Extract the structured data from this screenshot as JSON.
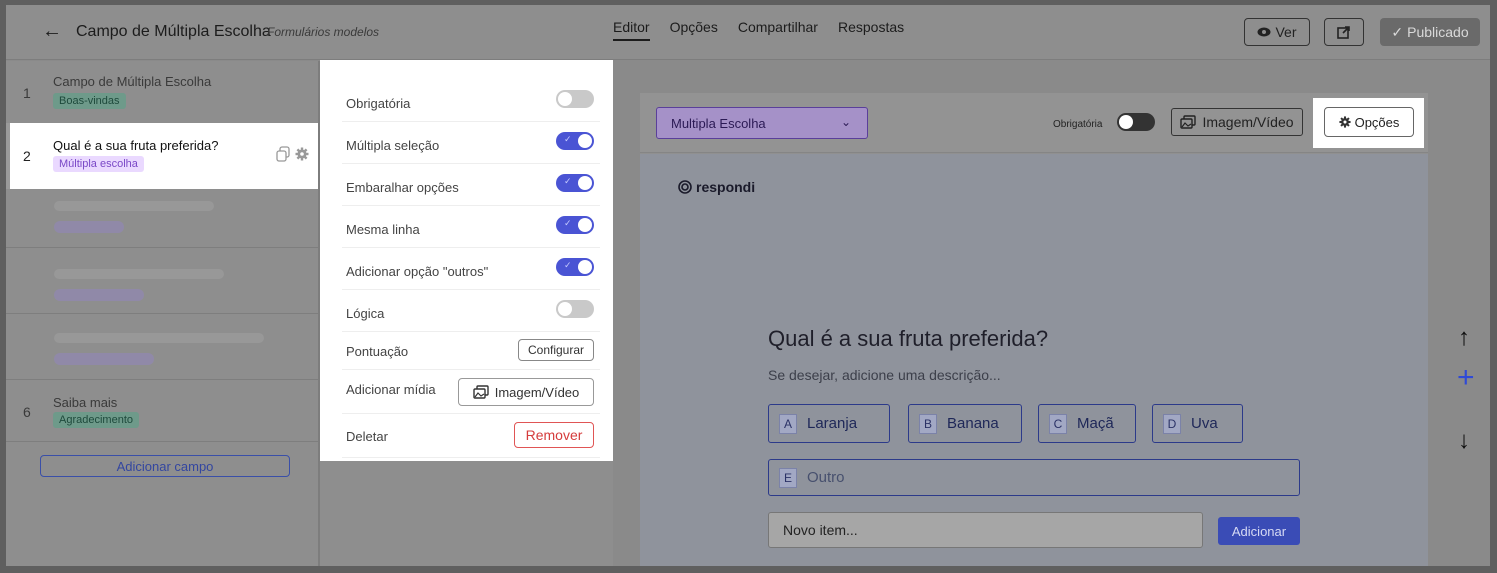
{
  "header": {
    "back_icon": "arrow-left-icon",
    "title": "Campo de Múltipla Escolha",
    "subtitle": "Formulários modelos",
    "tabs": [
      {
        "label": "Editor",
        "active": true
      },
      {
        "label": "Opções"
      },
      {
        "label": "Compartilhar"
      },
      {
        "label": "Respostas"
      }
    ],
    "view_button": "Ver",
    "publish_button": "Publicado"
  },
  "fields": {
    "items": [
      {
        "num": "1",
        "title": "Campo de Múltipla Escolha",
        "tag": "Boas-vindas"
      },
      {
        "num": "2",
        "title": "Qual é a sua fruta preferida?",
        "tag": "Múltipla escolha"
      },
      {
        "num": "6",
        "title": "Saiba mais",
        "tag": "Agradecimento"
      }
    ],
    "add_button": "Adicionar campo"
  },
  "settings": {
    "required": {
      "label": "Obrigatória",
      "on": false
    },
    "multi": {
      "label": "Múltipla seleção",
      "on": true
    },
    "shuffle": {
      "label": "Embaralhar opções",
      "on": true
    },
    "sameline": {
      "label": "Mesma linha",
      "on": true
    },
    "others": {
      "label": "Adicionar opção \"outros\"",
      "on": true
    },
    "logic": {
      "label": "Lógica",
      "on": false
    },
    "score": {
      "label": "Pontuação",
      "button": "Configurar"
    },
    "media": {
      "label": "Adicionar mídia",
      "button": "Imagem/Vídeo"
    },
    "delete": {
      "label": "Deletar",
      "button": "Remover"
    }
  },
  "preview": {
    "type_select": "Multipla Escolha",
    "required_label": "Obrigatória",
    "media_button": "Imagem/Vídeo",
    "options_button": "Opções",
    "logo_text": "respondi",
    "question": "Qual é a sua fruta preferida?",
    "description": "Se desejar, adicione uma descrição...",
    "options": [
      {
        "letter": "A",
        "label": "Laranja"
      },
      {
        "letter": "B",
        "label": "Banana"
      },
      {
        "letter": "C",
        "label": "Maçã"
      },
      {
        "letter": "D",
        "label": "Uva"
      }
    ],
    "other_option": {
      "letter": "E",
      "label": "Outro"
    },
    "new_item_placeholder": "Novo item...",
    "add_button": "Adicionar"
  },
  "colors": {
    "accent": "#4a54d4",
    "danger": "#d53c3c",
    "tag_purple_bg": "#ead9ff",
    "tag_purple_text": "#7a48c7"
  }
}
